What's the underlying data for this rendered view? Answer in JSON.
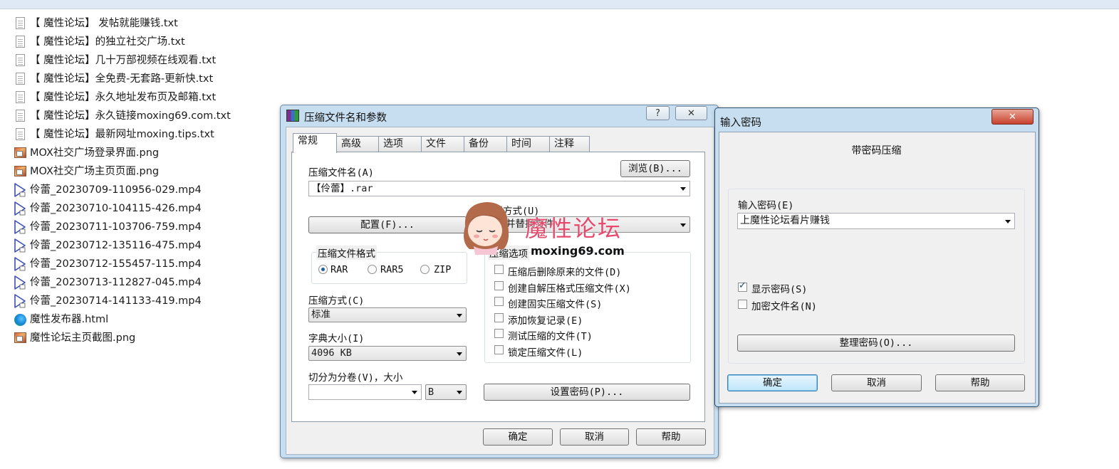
{
  "files": [
    {
      "name": "【 魔性论坛】 发帖就能赚钱.txt",
      "icon": "text-file-icon",
      "type": "txt"
    },
    {
      "name": "【 魔性论坛】的独立社交广场.txt",
      "icon": "text-file-icon",
      "type": "txt"
    },
    {
      "name": "【 魔性论坛】几十万部视频在线观看.txt",
      "icon": "text-file-icon",
      "type": "txt"
    },
    {
      "name": "【 魔性论坛】全免费-无套路-更新快.txt",
      "icon": "text-file-icon",
      "type": "txt"
    },
    {
      "name": "【 魔性论坛】永久地址发布页及邮箱.txt",
      "icon": "text-file-icon",
      "type": "txt"
    },
    {
      "name": "【 魔性论坛】永久链接moxing69.com.txt",
      "icon": "text-file-icon",
      "type": "txt"
    },
    {
      "name": "【 魔性论坛】最新网址moxing.tips.txt",
      "icon": "text-file-icon",
      "type": "txt"
    },
    {
      "name": "MOX社交广场登录界面.png",
      "icon": "image-file-icon",
      "type": "png"
    },
    {
      "name": "MOX社交广场主页页面.png",
      "icon": "image-file-icon",
      "type": "png"
    },
    {
      "name": "伶蕾_20230709-110956-029.mp4",
      "icon": "video-file-icon",
      "type": "mp4"
    },
    {
      "name": "伶蕾_20230710-104115-426.mp4",
      "icon": "video-file-icon",
      "type": "mp4"
    },
    {
      "name": "伶蕾_20230711-103706-759.mp4",
      "icon": "video-file-icon",
      "type": "mp4"
    },
    {
      "name": "伶蕾_20230712-135116-475.mp4",
      "icon": "video-file-icon",
      "type": "mp4"
    },
    {
      "name": "伶蕾_20230712-155457-115.mp4",
      "icon": "video-file-icon",
      "type": "mp4"
    },
    {
      "name": "伶蕾_20230713-112827-045.mp4",
      "icon": "video-file-icon",
      "type": "mp4"
    },
    {
      "name": "伶蕾_20230714-141133-419.mp4",
      "icon": "video-file-icon",
      "type": "mp4"
    },
    {
      "name": "魔性发布器.html",
      "icon": "edge-browser-icon",
      "type": "html"
    },
    {
      "name": "魔性论坛主页截图.png",
      "icon": "image-file-icon",
      "type": "png"
    }
  ],
  "archive_dialog": {
    "title": "压缩文件名和参数",
    "help_glyph": "?",
    "close_glyph": "✕",
    "tabs": [
      "常规",
      "高级",
      "选项",
      "文件",
      "备份",
      "时间",
      "注释"
    ],
    "archive_name_label": "压缩文件名(A)",
    "browse_button": "浏览(B)...",
    "archive_name_value": "【伶蕾】.rar",
    "update_mode_label": "更新方式(U)",
    "update_mode_value": "添加并替换文件",
    "profiles_button": "配置(F)...",
    "format_group_title": "压缩文件格式",
    "formats": [
      "RAR",
      "RAR5",
      "ZIP"
    ],
    "selected_format": "RAR",
    "method_label": "压缩方式(C)",
    "method_value": "标准",
    "dictionary_label": "字典大小(I)",
    "dictionary_value": "4096 KB",
    "split_label": "切分为分卷(V)，大小",
    "split_value": "",
    "split_unit": "B",
    "options_group_title": "压缩选项",
    "options": [
      {
        "label": "压缩后删除原来的文件(D)",
        "checked": false
      },
      {
        "label": "创建自解压格式压缩文件(X)",
        "checked": false
      },
      {
        "label": "创建固实压缩文件(S)",
        "checked": false
      },
      {
        "label": "添加恢复记录(E)",
        "checked": false
      },
      {
        "label": "测试压缩的文件(T)",
        "checked": false
      },
      {
        "label": "锁定压缩文件(L)",
        "checked": false
      }
    ],
    "set_password_button": "设置密码(P)...",
    "ok_button": "确定",
    "cancel_button": "取消",
    "help_button": "帮助"
  },
  "password_dialog": {
    "title": "输入密码",
    "close_glyph": "✕",
    "heading": "带密码压缩",
    "password_label": "输入密码(E)",
    "password_value": "上魔性论坛看片赚钱",
    "show_password_label": "显示密码(S)",
    "show_password_checked": true,
    "encrypt_names_label": "加密文件名(N)",
    "encrypt_names_checked": false,
    "organize_button": "整理密码(O)...",
    "ok_button": "确定",
    "cancel_button": "取消",
    "help_button": "帮助"
  },
  "watermark": {
    "text": "魔性论坛",
    "url": "moxing69.com",
    "color": "#e6496b"
  }
}
